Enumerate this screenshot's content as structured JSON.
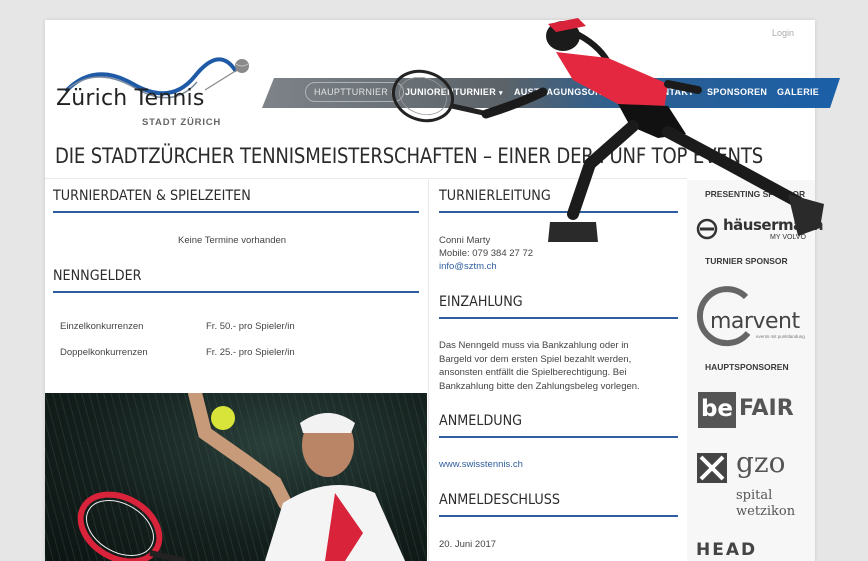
{
  "header": {
    "login_label": "Login",
    "logo_title": "Zürich Tennis",
    "logo_subtitle": "STADT ZÜRICH"
  },
  "nav": {
    "items": [
      {
        "label": "HAUPTTURNIER",
        "caret": "▾",
        "active": true
      },
      {
        "label": "JUNIORENTURNIER",
        "caret": "▾",
        "active": false
      },
      {
        "label": "AUSTRAGUNGSORTE",
        "active": false
      },
      {
        "label": "TEAM/KONTAKT",
        "active": false
      },
      {
        "label": "SPONSOREN",
        "active": false
      },
      {
        "label": "GALERIE",
        "active": false
      }
    ]
  },
  "headline": "DIE STADTZÜRCHER TENNISMEISTERSCHAFTEN – EINER DER FÜNF TOP EVENTS",
  "left_column": {
    "turnierdaten_title": "TURNIERDATEN & SPIELZEITEN",
    "no_dates": "Keine Termine vorhanden",
    "nenngelder_title": "NENNGELDER",
    "fees": [
      {
        "label": "Einzelkonkurrenzen",
        "value": "Fr. 50.- pro Spieler/in"
      },
      {
        "label": "Doppelkonkurrenzen",
        "value": "Fr. 25.- pro Spieler/in"
      }
    ]
  },
  "middle_column": {
    "turnierleitung_title": "TURNIERLEITUNG",
    "contact_name": "Conni Marty",
    "contact_mobile": "Mobile: 079 384 27 72",
    "contact_email": "info@sztm.ch",
    "einzahlung_title": "EINZAHLUNG",
    "einzahlung_lines": [
      "Das Nenngeld muss via Bankzahlung oder in",
      "Bargeld vor dem ersten Spiel bezahlt werden,",
      "ansonsten entfällt die Spielberechtigung. Bei",
      "Bankzahlung bitte den Zahlungsbeleg vorlegen."
    ],
    "anmeldung_title": "ANMELDUNG",
    "anmeldung_link": "www.swisstennis.ch",
    "anmeldeschluss_title": "ANMELDESCHLUSS",
    "anmeldeschluss_date": "20. Juni 2017"
  },
  "sidebar": {
    "presenting_label": "PRESENTING SPONSOR",
    "presenting_logo": "häusermann",
    "presenting_logo_sub": "MY VOLVO",
    "turnier_label": "TURNIER SPONSOR",
    "turnier_logo": "marvent",
    "turnier_logo_sub": "events mit punktlandung",
    "haupt_label": "HAUPTSPONSOREN",
    "haupt_logo_1": "FAIR",
    "haupt_logo_1_prefix": "be",
    "haupt_logo_2_lines": [
      "gzo",
      "spital",
      "wetzikon"
    ],
    "haupt_logo_3": "HEAD"
  },
  "colors": {
    "accent": "#2f5e9e",
    "nav_blue": "#1a5fa8",
    "nav_grey": "#5b6369",
    "shirt_red": "#d8233a"
  }
}
